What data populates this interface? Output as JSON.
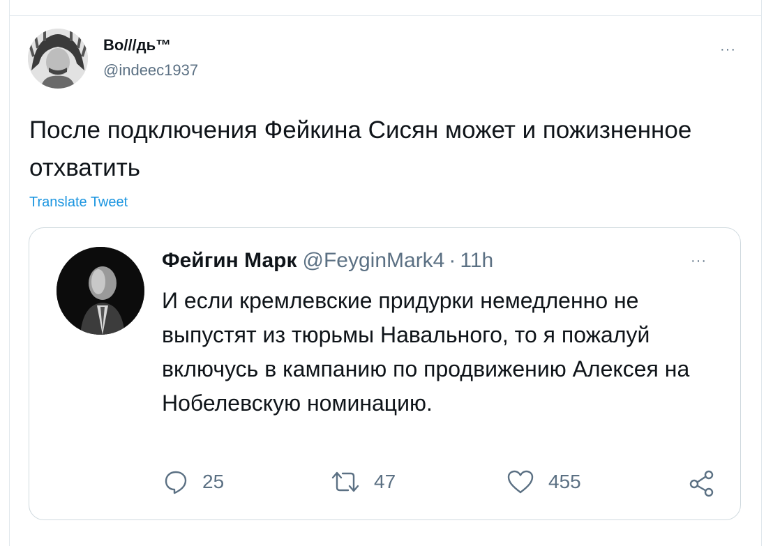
{
  "author": {
    "display_name": "Во///дь™",
    "handle": "@indeec1937"
  },
  "tweet": {
    "text": "После подключения Фейкина Сисян может и пожизненное отхватить",
    "translate_label": "Translate Tweet"
  },
  "quoted": {
    "name": "Фейгин Марк",
    "handle": "@FeyginMark4",
    "separator": "·",
    "time": "11h",
    "text": "И если кремлевские придурки немедленно не выпустят из тюрьмы Навального, то я пожалуй включусь в кампанию по продвижению Алексея на Нобелевскую номинацию.",
    "replies": "25",
    "retweets": "47",
    "likes": "455"
  },
  "menu": {
    "more_label": "···"
  },
  "icons": {
    "avatar": "avatar-icon",
    "more": "more-icon",
    "reply": "reply-icon",
    "retweet": "retweet-icon",
    "like": "like-icon",
    "share": "share-icon"
  },
  "colors": {
    "link": "#1b95e0",
    "secondary_text": "#5b7083",
    "border": "#cfd9de"
  }
}
